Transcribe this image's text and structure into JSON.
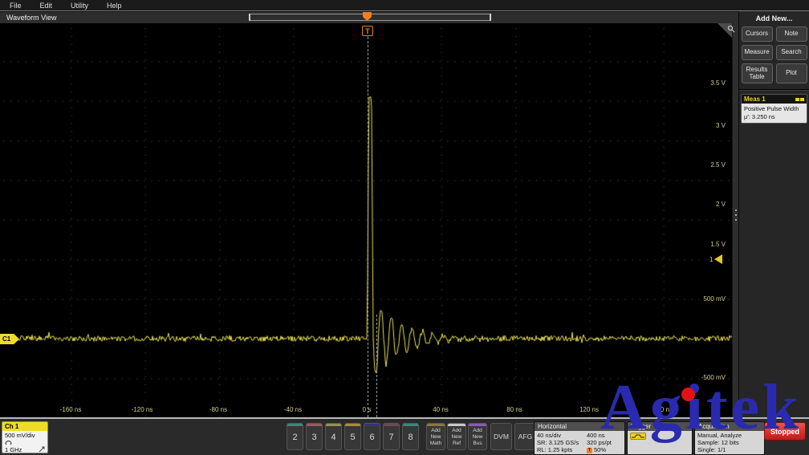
{
  "menu": {
    "items": [
      "File",
      "Edit",
      "Utility",
      "Help"
    ]
  },
  "view": {
    "title": "Waveform View"
  },
  "graticule": {
    "trigger_badge": "T",
    "channel_badge": "C1",
    "trigger_level_label": "1",
    "volt_labels": [
      "3.5 V",
      "3 V",
      "2.5 V",
      "2 V",
      "1.5 V",
      "500 mV",
      "-500 mV"
    ],
    "time_labels": [
      "-160 ns",
      "-120 ns",
      "-80 ns",
      "-40 ns",
      "0 s",
      "40 ns",
      "80 ns",
      "120 ns",
      "160 ns"
    ]
  },
  "waveform": {
    "channel": "Ch 1",
    "color": "#e8e050",
    "volts_per_div": 0.5,
    "time_per_div_ns": 40,
    "baseline_v": 0,
    "noise_v": 0.035,
    "pulse": {
      "start_ns": 0,
      "width_ns": 3.25,
      "peak_v": 3.05,
      "edge_ns": 0.9
    },
    "ring": {
      "start_ns": 3.3,
      "period_ns": 5.6,
      "amp_v": 0.5,
      "decay_ns": 16
    }
  },
  "right_panel": {
    "add_new_label": "Add New...",
    "buttons": [
      "Cursors",
      "Note",
      "Measure",
      "Search",
      "Results Table",
      "Plot"
    ],
    "meas": {
      "title": "Meas 1",
      "line1": "Positive Pulse Width",
      "line2": "μ′: 3.250 ns"
    }
  },
  "bottom_bar": {
    "ch1": {
      "label": "Ch 1",
      "scale": "500 mV/div",
      "bandwidth": "1 GHz"
    },
    "channels": [
      {
        "label": "2",
        "color": "#2f8f78"
      },
      {
        "label": "3",
        "color": "#9c5a5a"
      },
      {
        "label": "4",
        "color": "#95905a"
      },
      {
        "label": "5",
        "color": "#a98b41"
      },
      {
        "label": "6",
        "color": "#35356e"
      },
      {
        "label": "7",
        "color": "#6b4a57"
      },
      {
        "label": "8",
        "color": "#2f8f78"
      }
    ],
    "add_new_buttons": [
      {
        "label": "Add New Math",
        "color": "#8a7a35"
      },
      {
        "label": "Add New Ref",
        "color": "#c8c8c8"
      },
      {
        "label": "Add New Bus",
        "color": "#8a5ab4"
      }
    ],
    "dvm_label": "DVM",
    "afg_label": "AFG",
    "horizontal": {
      "title": "Horizontal",
      "rows": [
        [
          "40 ns/div",
          "400 ns"
        ],
        [
          "SR: 3.125 GS/s",
          "320 ps/pt"
        ],
        [
          "RL: 1.25 kpts",
          "50%"
        ]
      ],
      "pos_icon": "T"
    },
    "trigger": {
      "title": "Trigger"
    },
    "acquisition": {
      "title": "Acquisition",
      "lines": [
        "Manual, Analyze",
        "Sample: 12 bits",
        "Single: 1/1"
      ]
    },
    "stopped_label": "Stopped"
  },
  "watermark": {
    "part1": "Ag",
    "part2": "i",
    "part3": "tek",
    "color": "#2a2ab0",
    "dot_color": "#e21212"
  }
}
